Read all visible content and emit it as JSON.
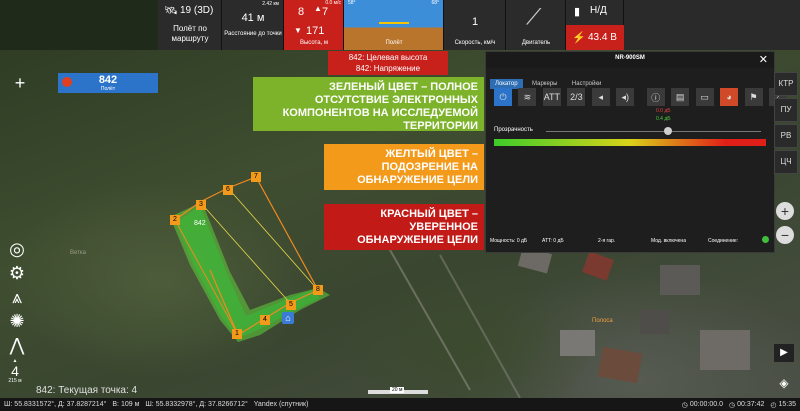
{
  "toolbar": {
    "satellites": "19 (3D)",
    "flight_mode": "Полёт по маршруту",
    "distance_to_point_value": "41 м",
    "distance_to_point_top": "2.42 км",
    "distance_to_point_label": "Расстояние до точки",
    "altitude_top_left": "8",
    "altitude_top_right": "7",
    "altitude_top_small": "0.0 м/с",
    "altitude_value": "171",
    "altitude_label": "Высота, м",
    "pitch_left": "58°",
    "pitch_right": "68°",
    "attitude_label": "Полёт",
    "speed_value": "1",
    "speed_label": "Скорость, км/ч",
    "engine_label": "Двигатель",
    "battery_status": "Н/Д",
    "voltage": "43.4 В"
  },
  "alerts": [
    "842: Целевая высота",
    "842: Напряжение"
  ],
  "drone_badge": {
    "id": "842",
    "status": "Полёт"
  },
  "legend": {
    "green": "ЗЕЛЕНЫЙ ЦВЕТ – ПОЛНОЕ ОТСУТСТВИЕ ЭЛЕКТРОННЫХ КОМПОНЕНТОВ НА ИССЛЕДУЕМОЙ ТЕРРИТОРИИ",
    "yellow": "ЖЕЛТЫЙ ЦВЕТ – ПОДОЗРЕНИЕ НА ОБНАРУЖЕНИЕ ЦЕЛИ",
    "red": "КРАСНЫЙ ЦВЕТ – УВЕРЕННОЕ ОБНАРУЖЕНИЕ ЦЕЛИ",
    "green_color": "#7cb32a",
    "yellow_color": "#f39a1b",
    "red_color": "#c21b17"
  },
  "sensor_panel": {
    "title": "NR-900SM",
    "tabs": [
      "Локатор",
      "Маркеры",
      "Настройки"
    ],
    "buttons": [
      "power-icon",
      "signal-icon",
      "АТТ",
      "2/3",
      "volume-down-icon",
      "volume-up-icon",
      "info-icon",
      "save-icon",
      "folder-icon",
      "palette-icon",
      "flag-icon",
      "brush-icon"
    ],
    "db_red": "0.0 дБ",
    "db_green": "0.4 дБ",
    "transparency_label": "Прозрачность",
    "transparency_value": 0.72,
    "power": "Мощность: 0 дБ",
    "att": "ATT: 0 дБ",
    "harmonic": "2-я гар.",
    "mode": "Мод. включена",
    "connection": "Соединение:"
  },
  "map": {
    "waypoint_labels": [
      "1",
      "2",
      "3",
      "4",
      "5",
      "6",
      "7",
      "8"
    ],
    "drone_label": "842",
    "area_label": "Полоса",
    "scale_text": "20 м",
    "current_point": "842: Текущая точка: 4",
    "altitude_indicator": "4",
    "altitude_indicator_sub": "215 м",
    "map_names": [
      "Ветка",
      "Полоса"
    ]
  },
  "right_buttons": [
    "КТР",
    "ПУ",
    "РВ",
    "ЦЧ"
  ],
  "statusbar": {
    "coords1": "Ш: 55.8331572°, Д: 37.8287214°",
    "alt1": "В: 109 м",
    "coords2": "Ш: 55.8332978°, Д: 37.8266712°",
    "provider": "Yandex (спутник)",
    "timer1": "00:00:00.0",
    "timer2": "00:37:42",
    "clock": "15:35"
  }
}
